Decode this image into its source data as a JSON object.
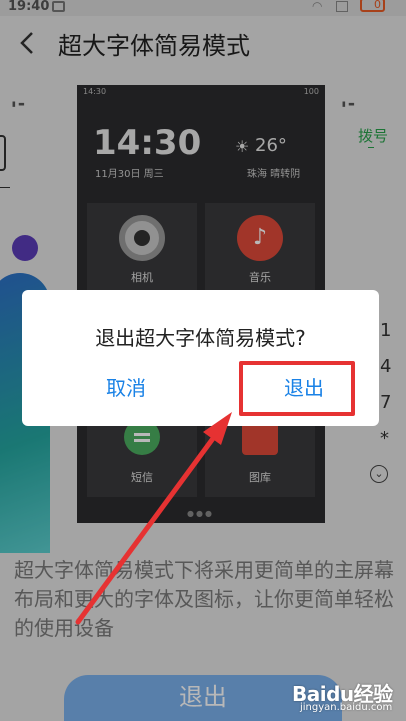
{
  "status_bar": {
    "time": "19:40",
    "battery": "0"
  },
  "header": {
    "title": "超大字体简易模式"
  },
  "preview": {
    "status_left": "14:30",
    "status_right": "100",
    "clock": "14:30",
    "date": "11月30日 周三",
    "temperature": "26°",
    "weather": "珠海  晴转阴",
    "tiles": [
      "相机",
      "音乐",
      "短信",
      "图库"
    ],
    "dots": "●●●"
  },
  "right_peek": {
    "dial": "拨号",
    "keys": [
      "1",
      "4",
      "7",
      "*"
    ]
  },
  "description": "超大字体简易模式下将采用更简单的主屏幕布局和更大的字体及图标，让你更简单轻松的使用设备",
  "bottom_button": {
    "label": "退出"
  },
  "dialog": {
    "title": "退出超大字体简易模式?",
    "cancel": "取消",
    "confirm": "退出"
  },
  "watermark": {
    "main": "Baidu经验",
    "sub": "jingyan.baidu.com"
  },
  "colors": {
    "accent": "#1a82e6",
    "highlight": "#e63232",
    "bottom_button": "#7bb0ec"
  }
}
